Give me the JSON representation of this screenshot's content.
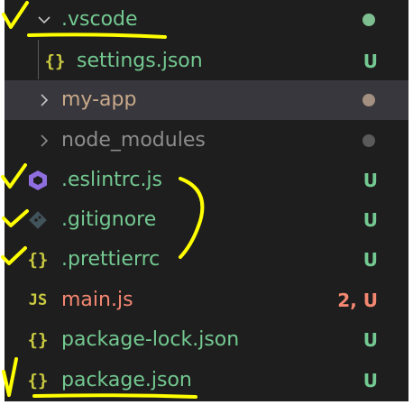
{
  "colors": {
    "panel_bg": "#1e1e1e",
    "selected_bg": "#37373d",
    "untracked_green": "#73c991",
    "modified_red": "#f48771",
    "ignored_gray": "#8c8c8c",
    "folder_text": "#c5c5c5",
    "json_yellow": "#cbcb41",
    "js_yellow": "#cbcb41",
    "eslint_purple": "#8f6edf",
    "git_gray": "#41535b",
    "annotation_yellow": "#ffff00"
  },
  "explorer": {
    "rows": [
      {
        "name": ".vscode",
        "kind": "folder",
        "expanded": true,
        "status_dot_color": "#7dbf91",
        "icon": "chevron-down-icon"
      },
      {
        "name": "settings.json",
        "kind": "file",
        "icon": "json-braces-icon",
        "status": "U"
      },
      {
        "name": "my-app",
        "kind": "folder",
        "expanded": false,
        "status_dot_color": "#a39081",
        "icon": "chevron-right-icon"
      },
      {
        "name": "node_modules",
        "kind": "folder",
        "expanded": false,
        "status_dot_color": "#5a5a5a",
        "icon": "chevron-right-icon"
      },
      {
        "name": ".eslintrc.js",
        "kind": "file",
        "icon": "eslint-icon",
        "status": "U"
      },
      {
        "name": ".gitignore",
        "kind": "file",
        "icon": "git-icon",
        "status": "U"
      },
      {
        "name": ".prettierrc",
        "kind": "file",
        "icon": "json-braces-icon",
        "status": "U"
      },
      {
        "name": "main.js",
        "kind": "file",
        "icon": "js-icon",
        "status": "2, U"
      },
      {
        "name": "package-lock.json",
        "kind": "file",
        "icon": "json-braces-icon",
        "status": "U"
      },
      {
        "name": "package.json",
        "kind": "file",
        "icon": "json-braces-icon",
        "status": "U"
      }
    ]
  },
  "icons": {
    "json_glyph": "{}",
    "js_glyph": "JS"
  }
}
